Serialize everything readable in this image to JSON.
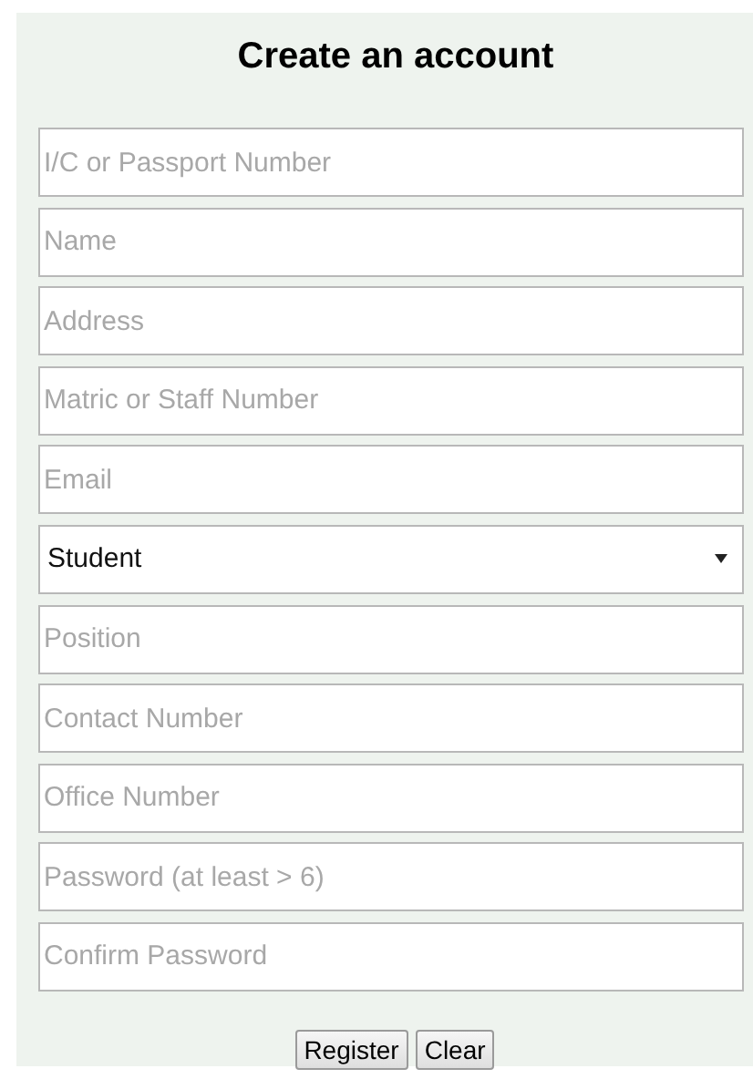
{
  "title": "Create an account",
  "fields": [
    {
      "kind": "text",
      "placeholder": "I/C or Passport Number"
    },
    {
      "kind": "text",
      "placeholder": "Name"
    },
    {
      "kind": "text",
      "placeholder": "Address"
    },
    {
      "kind": "text",
      "placeholder": "Matric or Staff Number"
    },
    {
      "kind": "text",
      "placeholder": "Email"
    },
    {
      "kind": "select",
      "value": "Student"
    },
    {
      "kind": "text",
      "placeholder": "Position"
    },
    {
      "kind": "text",
      "placeholder": "Contact Number"
    },
    {
      "kind": "text",
      "placeholder": "Office Number"
    },
    {
      "kind": "password",
      "placeholder": "Password (at least > 6)"
    },
    {
      "kind": "password",
      "placeholder": "Confirm Password"
    }
  ],
  "buttons": [
    "Register",
    "Clear"
  ]
}
